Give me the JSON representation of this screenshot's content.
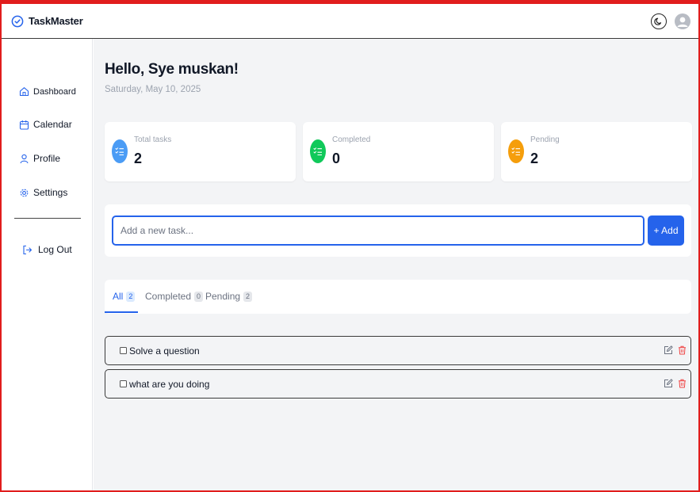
{
  "app": {
    "name": "TaskMaster"
  },
  "colors": {
    "accent": "#2563eb",
    "total": "#4b9cf5",
    "completed": "#10c95a",
    "pending": "#f59e0b",
    "danger": "#ef4444"
  },
  "sidebar": {
    "items": [
      {
        "label": "Dashboard",
        "icon": "home-icon"
      },
      {
        "label": "Calendar",
        "icon": "calendar-icon"
      },
      {
        "label": "Profile",
        "icon": "user-icon"
      },
      {
        "label": "Settings",
        "icon": "gear-icon"
      }
    ],
    "logout_label": "Log Out"
  },
  "main": {
    "greeting": "Hello, Sye muskan!",
    "date": "Saturday, May 10, 2025",
    "stats": [
      {
        "label": "Total tasks",
        "value": "2",
        "icon": "list-check-icon"
      },
      {
        "label": "Completed",
        "value": "0",
        "icon": "list-check-icon"
      },
      {
        "label": "Pending",
        "value": "2",
        "icon": "list-check-icon"
      }
    ],
    "add": {
      "placeholder": "Add a new task...",
      "value": "",
      "button_label": "+ Add"
    },
    "tabs": [
      {
        "label": "All",
        "count": "2",
        "active": true
      },
      {
        "label": "Completed",
        "count": "0",
        "active": false
      },
      {
        "label": "Pending",
        "count": "2",
        "active": false
      }
    ],
    "tasks": [
      {
        "text": "Solve a question",
        "completed": false
      },
      {
        "text": "what are you doing",
        "completed": false
      }
    ]
  }
}
